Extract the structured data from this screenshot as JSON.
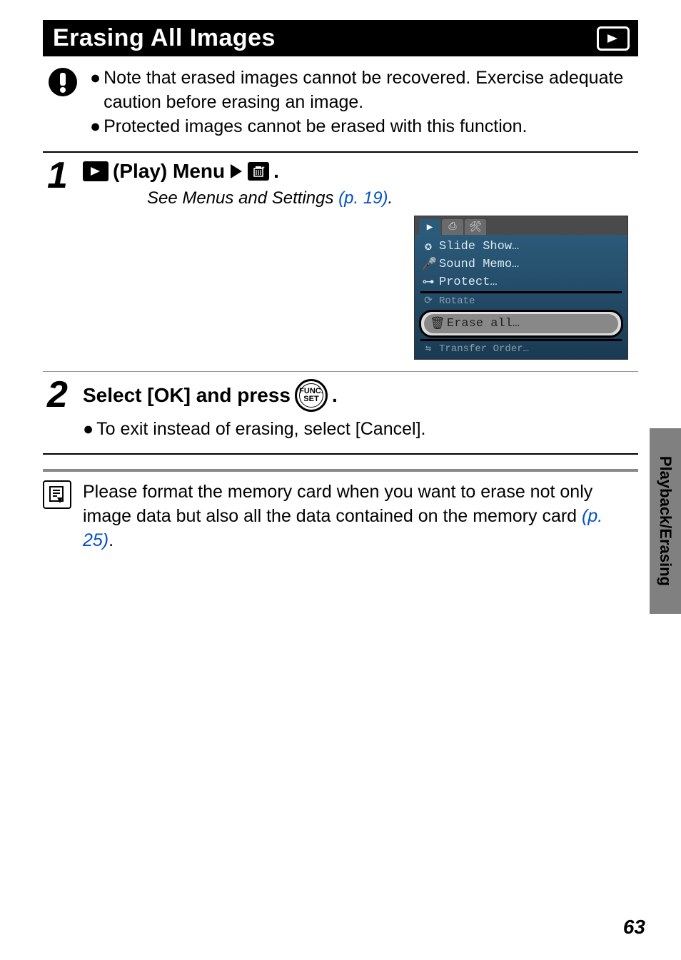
{
  "title": "Erasing All Images",
  "warnings": [
    "Note that erased images cannot be recovered. Exercise adequate caution before erasing an image.",
    "Protected images cannot be erased with this function."
  ],
  "steps": {
    "s1": {
      "num": "1",
      "heading_prefix": "(Play) Menu",
      "heading_suffix": ".",
      "sub_prefix": "See Menus and Settings ",
      "sub_link": "(p. 19)",
      "sub_suffix": ".",
      "menu": {
        "items": [
          "Slide Show…",
          "Sound Memo…",
          "Protect…",
          "Rotate",
          "Erase all…",
          "Transfer Order…"
        ]
      }
    },
    "s2": {
      "num": "2",
      "heading_a": "Select [OK] and press ",
      "heading_b": ".",
      "func_top": "FUNC.",
      "func_bot": "SET",
      "bullet": "To exit instead of erasing, select [Cancel]."
    }
  },
  "note": {
    "text_a": "Please format the memory card when you want to erase not only image data but also all the data contained on the memory card ",
    "link": "(p. 25)",
    "text_b": "."
  },
  "side_tab": "Playback/Erasing",
  "page_number": "63"
}
